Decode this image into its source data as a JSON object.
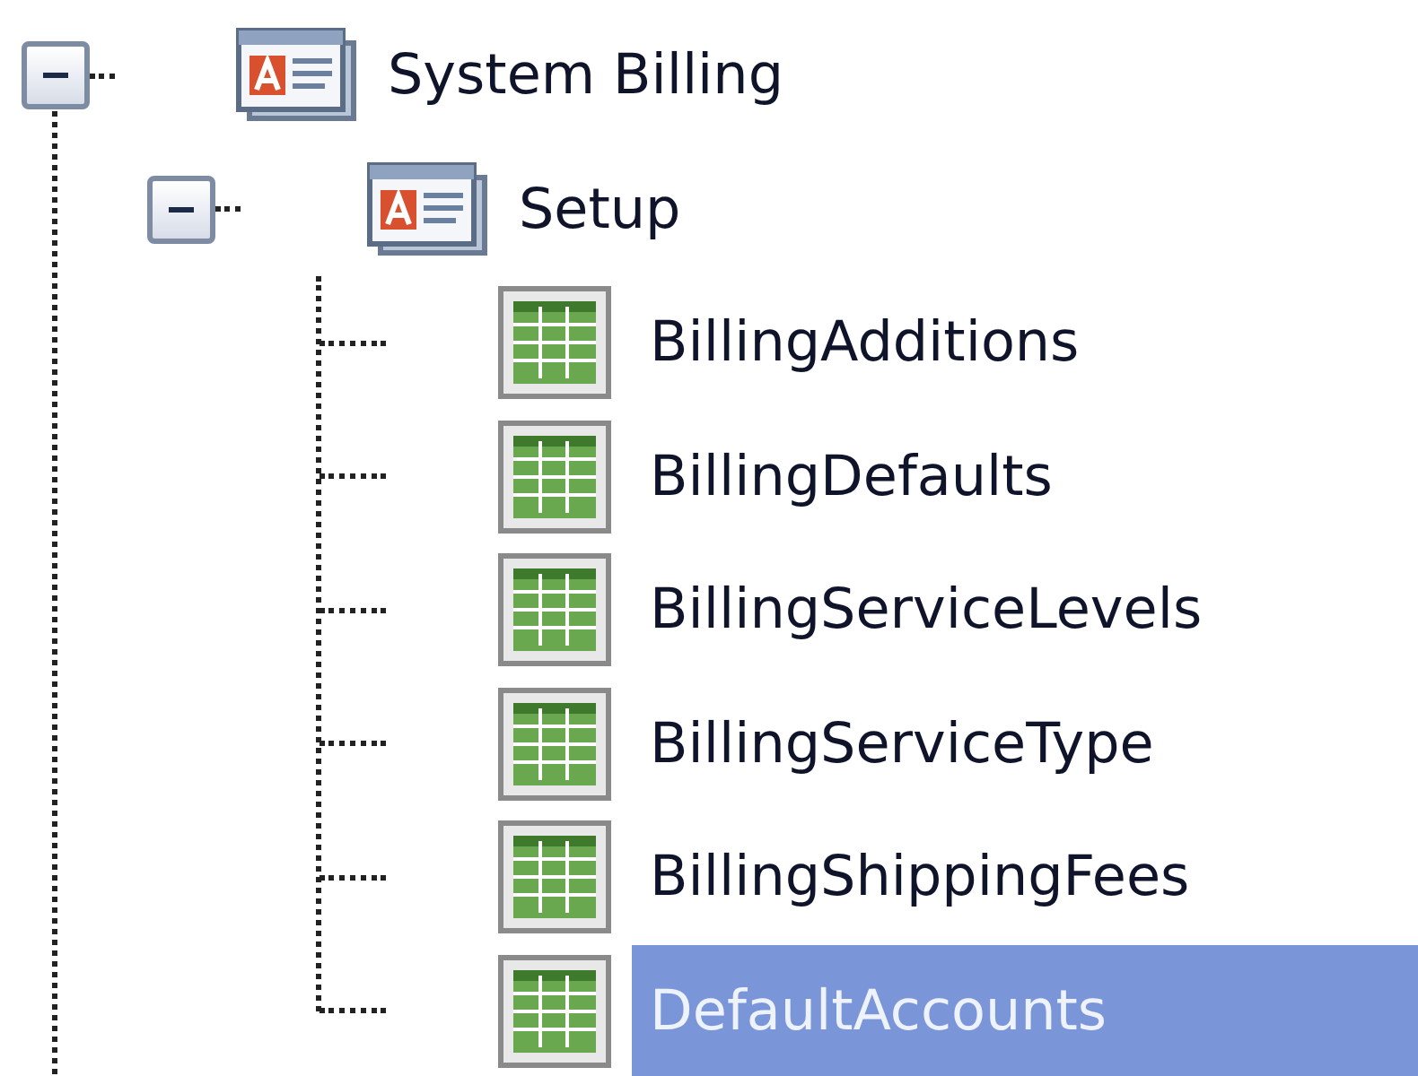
{
  "tree": [
    {
      "label": "System Billing",
      "kind": "form",
      "expanded": true,
      "selected": false,
      "children": [
        {
          "label": "Setup",
          "kind": "form",
          "expanded": true,
          "selected": false,
          "children": [
            {
              "label": "BillingAdditions",
              "kind": "table",
              "selected": false
            },
            {
              "label": "BillingDefaults",
              "kind": "table",
              "selected": false
            },
            {
              "label": "BillingServiceLevels",
              "kind": "table",
              "selected": false
            },
            {
              "label": "BillingServiceType",
              "kind": "table",
              "selected": false
            },
            {
              "label": "BillingShippingFees",
              "kind": "table",
              "selected": false
            },
            {
              "label": "DefaultAccounts",
              "kind": "table",
              "selected": true
            }
          ]
        }
      ]
    }
  ]
}
